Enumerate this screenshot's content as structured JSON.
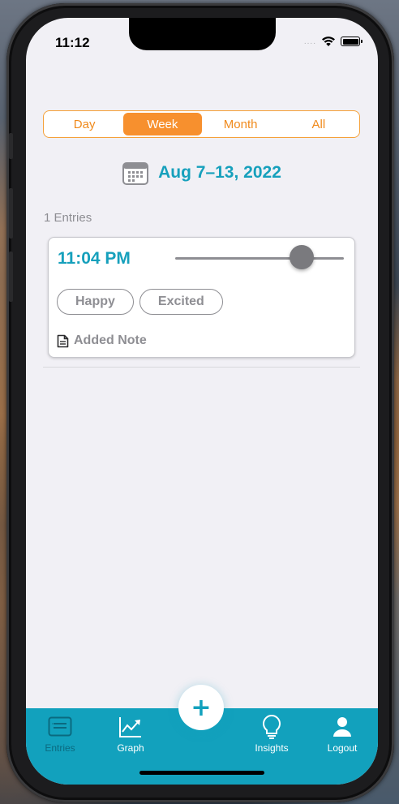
{
  "status_bar": {
    "time": "11:12",
    "signal": "....",
    "wifi_icon": "wifi-icon",
    "battery_icon": "battery-icon"
  },
  "segmented": {
    "items": [
      {
        "label": "Day",
        "active": false
      },
      {
        "label": "Week",
        "active": true
      },
      {
        "label": "Month",
        "active": false
      },
      {
        "label": "All",
        "active": false
      }
    ],
    "accent": "#f7902e"
  },
  "date_header": {
    "icon": "calendar-icon",
    "label": "Aug 7–13, 2022",
    "color": "#16a0bc"
  },
  "entries": {
    "count_label": "1 Entries",
    "items": [
      {
        "time": "11:04 PM",
        "mood_level": 0.75,
        "tags": [
          "Happy",
          "Excited"
        ],
        "note_icon": "document-icon",
        "note_label": "Added Note"
      }
    ]
  },
  "tab_bar": {
    "background": "#12a1bd",
    "tabs": [
      {
        "label": "Entries",
        "icon": "entries-list-icon",
        "active": true
      },
      {
        "label": "Graph",
        "icon": "graph-trend-icon",
        "active": false
      },
      {
        "label": "Insights",
        "icon": "lightbulb-icon",
        "active": false
      },
      {
        "label": "Logout",
        "icon": "user-icon",
        "active": false
      }
    ],
    "add_button": {
      "label": "+",
      "icon": "plus-icon"
    }
  }
}
